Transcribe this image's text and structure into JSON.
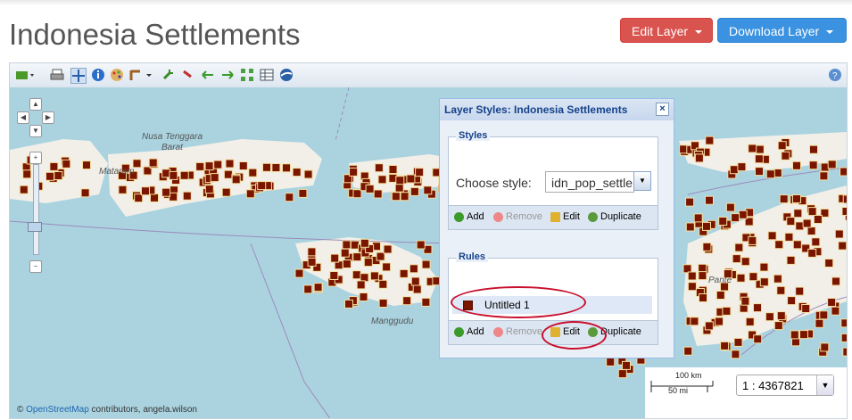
{
  "page": {
    "title": "Indonesia Settlements"
  },
  "header": {
    "edit_layer": "Edit Layer",
    "download_layer": "Download Layer"
  },
  "map": {
    "labels": [
      "Nusa Tenggara",
      "Barat",
      "Manggudu",
      "Pante",
      "Mataram"
    ],
    "attribution": {
      "prefix": "©",
      "link": "OpenStreetMap",
      "suffix": "contributors, angela.wilson"
    },
    "scale": {
      "km": "100 km",
      "mi": "50 mi",
      "ratio": "1 : 4367821"
    }
  },
  "styles_window": {
    "title": "Layer Styles: Indonesia Settlements",
    "styles_legend": "Styles",
    "choose_label": "Choose style:",
    "choose_value": "idn_pop_settle",
    "rules_legend": "Rules",
    "rule_name": "Untitled 1",
    "actions": {
      "add": "Add",
      "remove": "Remove",
      "edit": "Edit",
      "duplicate": "Duplicate"
    }
  },
  "colors": {
    "settlement": "#7a1600",
    "land": "#f2efe9",
    "sea": "#aad3df",
    "highlight": "#c8102e"
  }
}
